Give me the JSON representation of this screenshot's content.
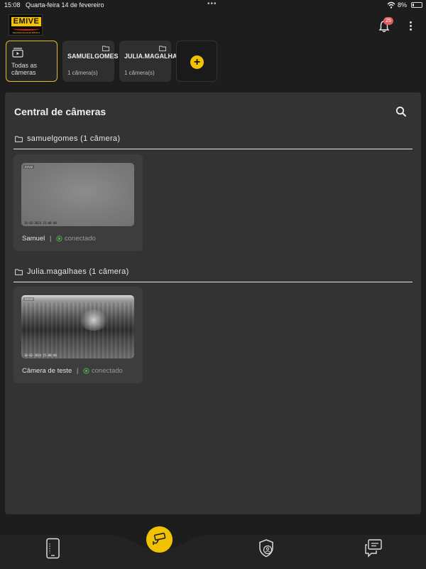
{
  "status_bar": {
    "time": "15:08",
    "date": "Quarta-feira 14 de fevereiro",
    "battery": "8%"
  },
  "header": {
    "logo_text": "EMIVE",
    "logo_subtitle": "SEGURANÇA ELETRÔNICA",
    "notification_count": "25"
  },
  "filters": {
    "all": {
      "label": "Todas as câmeras",
      "selected": true,
      "icon": "camera-list-icon"
    },
    "groups": [
      {
        "title": "SAMUELGOMES",
        "subtitle": "1 câmera(s)",
        "icon": "folder-icon"
      },
      {
        "title": "JULIA.MAGALHAES",
        "subtitle": "1 câmera(s)",
        "icon": "folder-icon"
      }
    ],
    "add_label": "+"
  },
  "panel": {
    "title": "Central de câmeras",
    "groups": [
      {
        "label": "samuelgomes (1 câmera)",
        "cameras": [
          {
            "name": "Samuel",
            "status": "conectado",
            "brand": "EZVIZ",
            "timestamp": "14-02-2024 15:08:00"
          }
        ]
      },
      {
        "label": "Julia.magalhaes (1 câmera)",
        "cameras": [
          {
            "name": "Câmera de teste",
            "status": "conectado",
            "brand": "EZVIZ",
            "timestamp": "14-02-2024 15:08:00"
          }
        ]
      }
    ]
  },
  "bottom_nav": {
    "items": [
      "document-phone-icon",
      "cctv-camera-icon",
      "shield-user-icon",
      "chat-icon"
    ],
    "active": "cctv-camera-icon"
  },
  "colors": {
    "accent": "#f2c200",
    "background": "#1d1d1d",
    "panel": "#333333",
    "card": "#3d3d3d",
    "status_ok": "#4caf50",
    "badge": "#e35d5d"
  }
}
